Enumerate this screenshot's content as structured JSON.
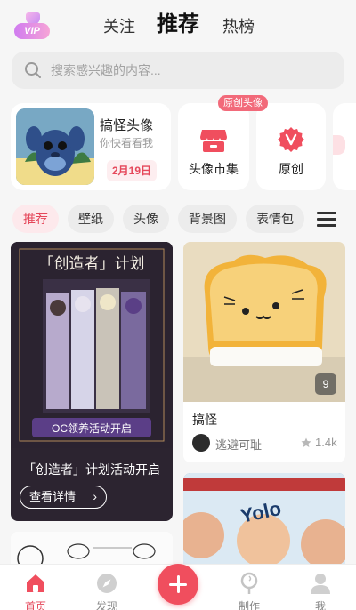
{
  "header": {
    "vip_label": "VIP",
    "tabs": [
      {
        "label": "关注",
        "active": false
      },
      {
        "label": "推荐",
        "active": true
      },
      {
        "label": "热榜",
        "active": false
      }
    ]
  },
  "search": {
    "placeholder": "搜索感兴趣的内容..."
  },
  "features": {
    "main": {
      "title": "搞怪头像",
      "subtitle": "你快看看我",
      "date": "2月19日"
    },
    "badge": "原创头像",
    "items": [
      {
        "label": "头像市集",
        "icon": "shop-icon"
      },
      {
        "label": "原创",
        "icon": "v-badge-icon"
      }
    ]
  },
  "categories": [
    "推荐",
    "壁纸",
    "头像",
    "背景图",
    "表情包"
  ],
  "feed": {
    "big_post": {
      "art_title": "「创造者」计划",
      "art_banner": "OC领养活动开启",
      "caption": "「创造者」计划活动开启",
      "button": "查看详情"
    },
    "right_post": {
      "image_count": "9",
      "title": "搞怪",
      "author": "逃避可耻",
      "likes": "1.4k"
    },
    "bottom_right": {
      "text": "Yolo"
    }
  },
  "bottom_nav": [
    {
      "label": "首页",
      "icon": "home-icon",
      "active": true
    },
    {
      "label": "发现",
      "icon": "compass-icon",
      "active": false
    },
    {
      "label": "制作",
      "icon": "lollipop-icon",
      "active": false
    },
    {
      "label": "我",
      "icon": "user-icon",
      "active": false
    }
  ],
  "colors": {
    "accent": "#e5485b",
    "add_button": "#f04e5e"
  }
}
